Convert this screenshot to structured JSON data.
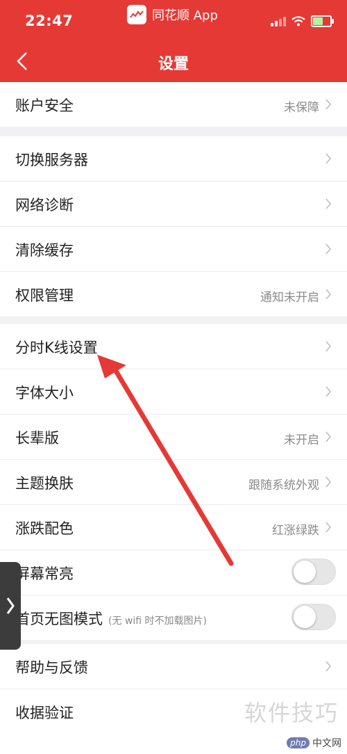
{
  "status": {
    "time": "22:47"
  },
  "app_pill": {
    "name": "同花顺 App"
  },
  "header": {
    "title": "设置"
  },
  "groups": [
    {
      "items": [
        {
          "label": "账户安全",
          "value": "未保障"
        }
      ]
    },
    {
      "items": [
        {
          "label": "切换服务器",
          "value": ""
        },
        {
          "label": "网络诊断",
          "value": ""
        },
        {
          "label": "清除缓存",
          "value": ""
        },
        {
          "label": "权限管理",
          "value": "通知未开启"
        }
      ]
    },
    {
      "items": [
        {
          "label": "分时K线设置",
          "value": ""
        },
        {
          "label": "字体大小",
          "value": ""
        },
        {
          "label": "长辈版",
          "value": "未开启"
        },
        {
          "label": "主题换肤",
          "value": "跟随系统外观"
        },
        {
          "label": "涨跌配色",
          "value": "红涨绿跌"
        },
        {
          "label": "屏幕常亮",
          "toggle": "off"
        },
        {
          "label": "首页无图模式",
          "note": "(无 wifi 时不加载图片)",
          "toggle": "off"
        }
      ]
    },
    {
      "items": [
        {
          "label": "帮助与反馈",
          "value": ""
        },
        {
          "label": "收据验证",
          "value": ""
        }
      ]
    }
  ],
  "watermark": {
    "text": "软件技巧",
    "logo_badge": "php",
    "logo_text": "中文网"
  },
  "colors": {
    "header": "#e53935",
    "annotation_arrow": "#e53935"
  }
}
